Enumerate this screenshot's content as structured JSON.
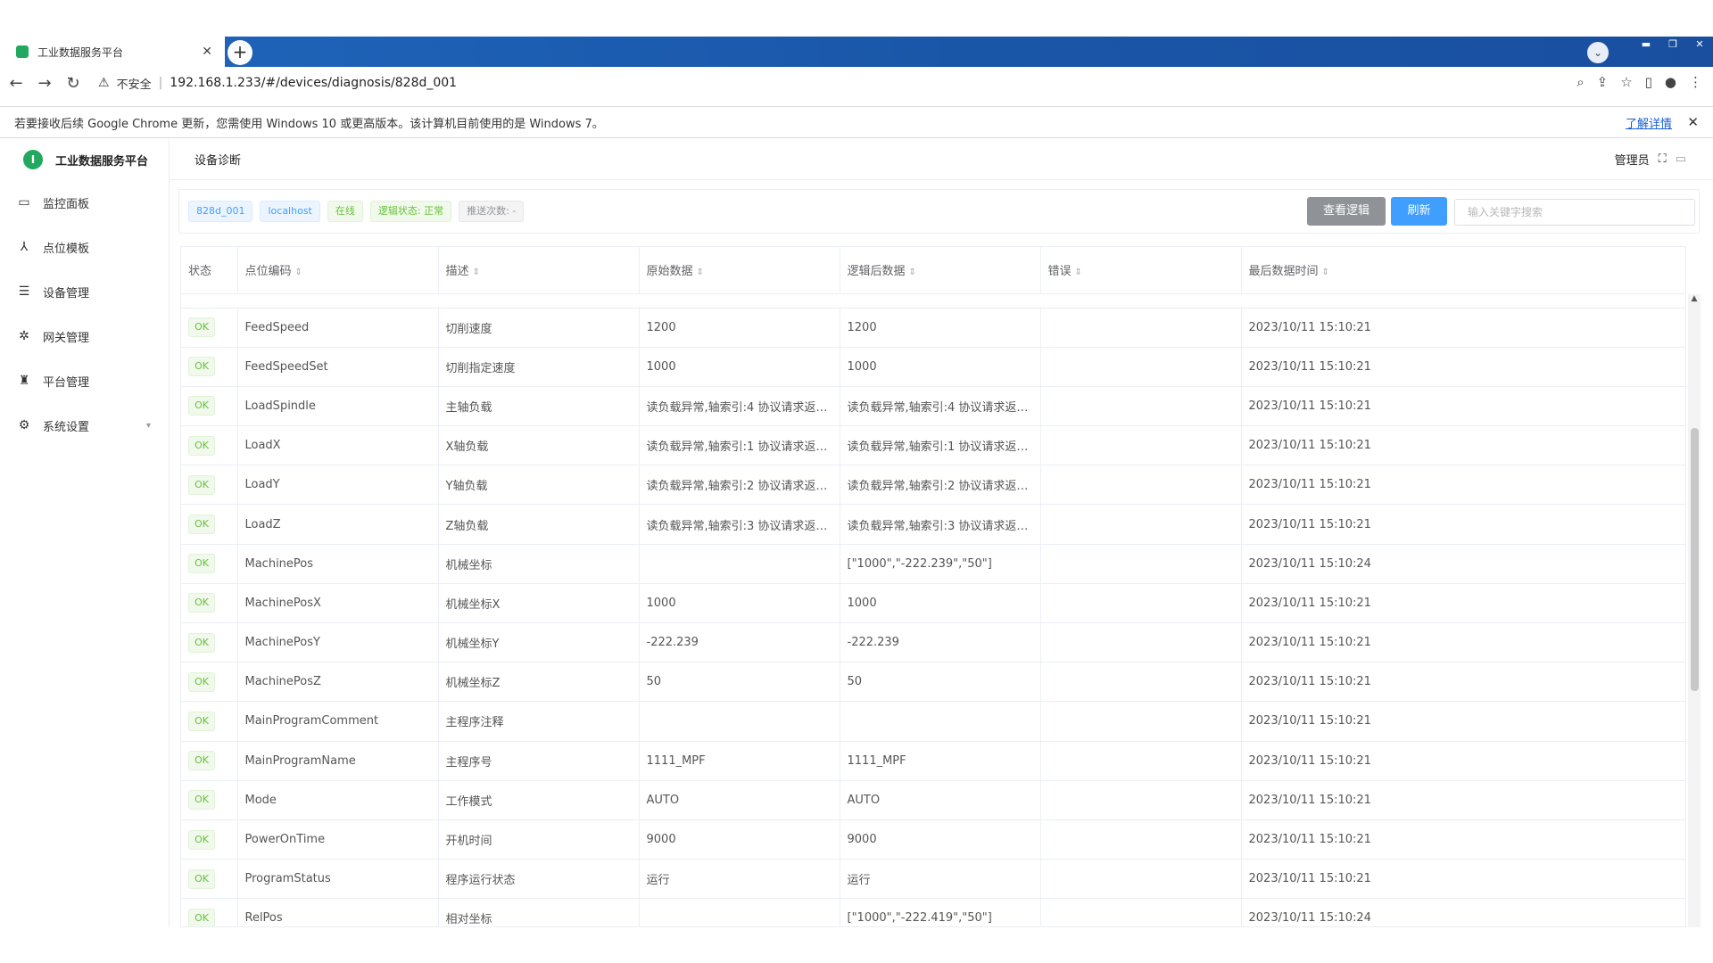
{
  "browser": {
    "tab_title": "工业数据服务平台",
    "insecure_label": "不安全",
    "url": "192.168.1.233/#/devices/diagnosis/828d_001",
    "infobar_text": "若要接收后续 Google Chrome 更新，您需使用 Windows 10 或更高版本。该计算机目前使用的是 Windows 7。",
    "infobar_link": "了解详情"
  },
  "app": {
    "brand": "工业数据服务平台",
    "page_title": "设备诊断",
    "user": "管理员",
    "menu": [
      {
        "label": "监控面板",
        "icon": "monitor-icon"
      },
      {
        "label": "点位模板",
        "icon": "template-icon"
      },
      {
        "label": "设备管理",
        "icon": "device-icon"
      },
      {
        "label": "网关管理",
        "icon": "gateway-icon"
      },
      {
        "label": "平台管理",
        "icon": "platform-icon"
      },
      {
        "label": "系统设置",
        "icon": "gear-icon"
      }
    ]
  },
  "toolbar": {
    "tags": [
      "828d_001",
      "localhost",
      "在线",
      "逻辑状态: 正常",
      "推送次数: -"
    ],
    "view_logic": "查看逻辑",
    "refresh": "刷新",
    "search_placeholder": "输入关键字搜索"
  },
  "table": {
    "headers": [
      "状态",
      "点位编码",
      "描述",
      "原始数据",
      "逻辑后数据",
      "错误",
      "最后数据时间"
    ],
    "rows": [
      {
        "status": "OK",
        "code": "FeedSpeed",
        "desc": "切削速度",
        "raw": "1200",
        "logic": "1200",
        "error": "",
        "time": "2023/10/11 15:10:21"
      },
      {
        "status": "OK",
        "code": "FeedSpeedSet",
        "desc": "切削指定速度",
        "raw": "1000",
        "logic": "1000",
        "error": "",
        "time": "2023/10/11 15:10:21"
      },
      {
        "status": "OK",
        "code": "LoadSpindle",
        "desc": "主轴负载",
        "raw": "读负载异常,轴索引:4 协议请求返…",
        "logic": "读负载异常,轴索引:4 协议请求返…",
        "error": "",
        "time": "2023/10/11 15:10:21"
      },
      {
        "status": "OK",
        "code": "LoadX",
        "desc": "X轴负载",
        "raw": "读负载异常,轴索引:1 协议请求返…",
        "logic": "读负载异常,轴索引:1 协议请求返…",
        "error": "",
        "time": "2023/10/11 15:10:21"
      },
      {
        "status": "OK",
        "code": "LoadY",
        "desc": "Y轴负载",
        "raw": "读负载异常,轴索引:2 协议请求返…",
        "logic": "读负载异常,轴索引:2 协议请求返…",
        "error": "",
        "time": "2023/10/11 15:10:21"
      },
      {
        "status": "OK",
        "code": "LoadZ",
        "desc": "Z轴负载",
        "raw": "读负载异常,轴索引:3 协议请求返…",
        "logic": "读负载异常,轴索引:3 协议请求返…",
        "error": "",
        "time": "2023/10/11 15:10:21"
      },
      {
        "status": "OK",
        "code": "MachinePos",
        "desc": "机械坐标",
        "raw": "",
        "logic": "[\"1000\",\"-222.239\",\"50\"]",
        "error": "",
        "time": "2023/10/11 15:10:24"
      },
      {
        "status": "OK",
        "code": "MachinePosX",
        "desc": "机械坐标X",
        "raw": "1000",
        "logic": "1000",
        "error": "",
        "time": "2023/10/11 15:10:21"
      },
      {
        "status": "OK",
        "code": "MachinePosY",
        "desc": "机械坐标Y",
        "raw": "-222.239",
        "logic": "-222.239",
        "error": "",
        "time": "2023/10/11 15:10:21"
      },
      {
        "status": "OK",
        "code": "MachinePosZ",
        "desc": "机械坐标Z",
        "raw": "50",
        "logic": "50",
        "error": "",
        "time": "2023/10/11 15:10:21"
      },
      {
        "status": "OK",
        "code": "MainProgramComment",
        "desc": "主程序注释",
        "raw": "",
        "logic": "",
        "error": "",
        "time": "2023/10/11 15:10:21"
      },
      {
        "status": "OK",
        "code": "MainProgramName",
        "desc": "主程序号",
        "raw": "1111_MPF",
        "logic": "1111_MPF",
        "error": "",
        "time": "2023/10/11 15:10:21"
      },
      {
        "status": "OK",
        "code": "Mode",
        "desc": "工作模式",
        "raw": "AUTO",
        "logic": "AUTO",
        "error": "",
        "time": "2023/10/11 15:10:21"
      },
      {
        "status": "OK",
        "code": "PowerOnTime",
        "desc": "开机时间",
        "raw": "9000",
        "logic": "9000",
        "error": "",
        "time": "2023/10/11 15:10:21"
      },
      {
        "status": "OK",
        "code": "ProgramStatus",
        "desc": "程序运行状态",
        "raw": "运行",
        "logic": "运行",
        "error": "",
        "time": "2023/10/11 15:10:21"
      },
      {
        "status": "OK",
        "code": "RelPos",
        "desc": "相对坐标",
        "raw": "",
        "logic": "[\"1000\",\"-222.419\",\"50\"]",
        "error": "",
        "time": "2023/10/11 15:10:24"
      }
    ]
  }
}
